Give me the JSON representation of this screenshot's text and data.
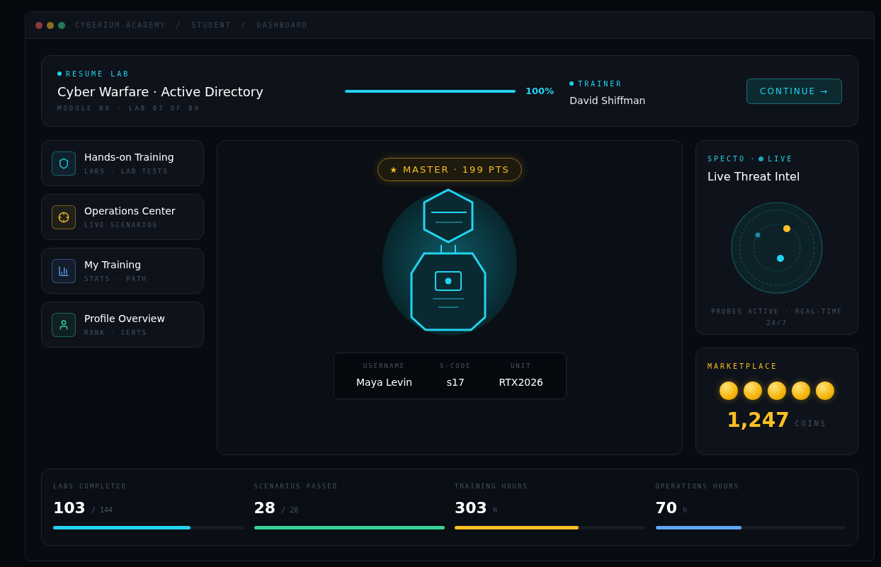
{
  "window": {
    "breadcrumb": [
      "CYBERIUM.ACADEMY",
      "/",
      "STUDENT",
      "/",
      "DASHBOARD"
    ]
  },
  "resume": {
    "eyebrow": "RESUME LAB",
    "title": "Cyber Warfare · Active Directory",
    "subtitle": "MODULE 04 · LAB 07 OF 09",
    "level": 1.0,
    "percent": "100%",
    "trainer_label": "TRAINER",
    "trainer": "David Shiffman",
    "button": "CONTINUE →"
  },
  "nav": [
    {
      "kind": "shield",
      "title": "Hands-on Training",
      "subtitle": "LABS · LAB TESTS",
      "color": "#22d3ee"
    },
    {
      "kind": "crosshair",
      "title": "Operations Center",
      "subtitle": "LIVE SCENARIOS",
      "color": "#fbbf24"
    },
    {
      "kind": "chart",
      "title": "My Training",
      "subtitle": "STATS · PATH",
      "color": "#60a5fa"
    },
    {
      "kind": "user",
      "title": "Profile Overview",
      "subtitle": "RANK · CERTS",
      "color": "#34d399"
    }
  ],
  "avatar": {
    "badge_icon": "★",
    "badge": "MASTER · 199 PTS",
    "fields": [
      {
        "label": "USERNAME",
        "value": "Maya Levin"
      },
      {
        "label": "S-CODE",
        "value": "s17"
      },
      {
        "label": "UNIT",
        "value": "RTX2026"
      }
    ]
  },
  "intel": {
    "source": "SPECTO",
    "separator": "·",
    "live": "LIVE",
    "title": "Live Threat Intel",
    "footer": "PROBES ACTIVE · REAL-TIME 24/7"
  },
  "marketplace": {
    "label": "MARKETPLACE",
    "amount": "1,247",
    "unit": "COINS"
  },
  "stats": [
    {
      "label": "LABS COMPLETED",
      "value": "103",
      "suffix": "/ 144",
      "level": 0.72,
      "color": "#22d3ee"
    },
    {
      "label": "SCENARIOS PASSED",
      "value": "28",
      "suffix": "/ 28",
      "level": 1.0,
      "color": "#34d399"
    },
    {
      "label": "TRAINING HOURS",
      "value": "303",
      "suffix": "h",
      "level": 0.65,
      "color": "#fbbf24"
    },
    {
      "label": "OPERATIONS HOURS",
      "value": "70",
      "suffix": "h",
      "level": 0.45,
      "color": "#60a5fa"
    }
  ]
}
